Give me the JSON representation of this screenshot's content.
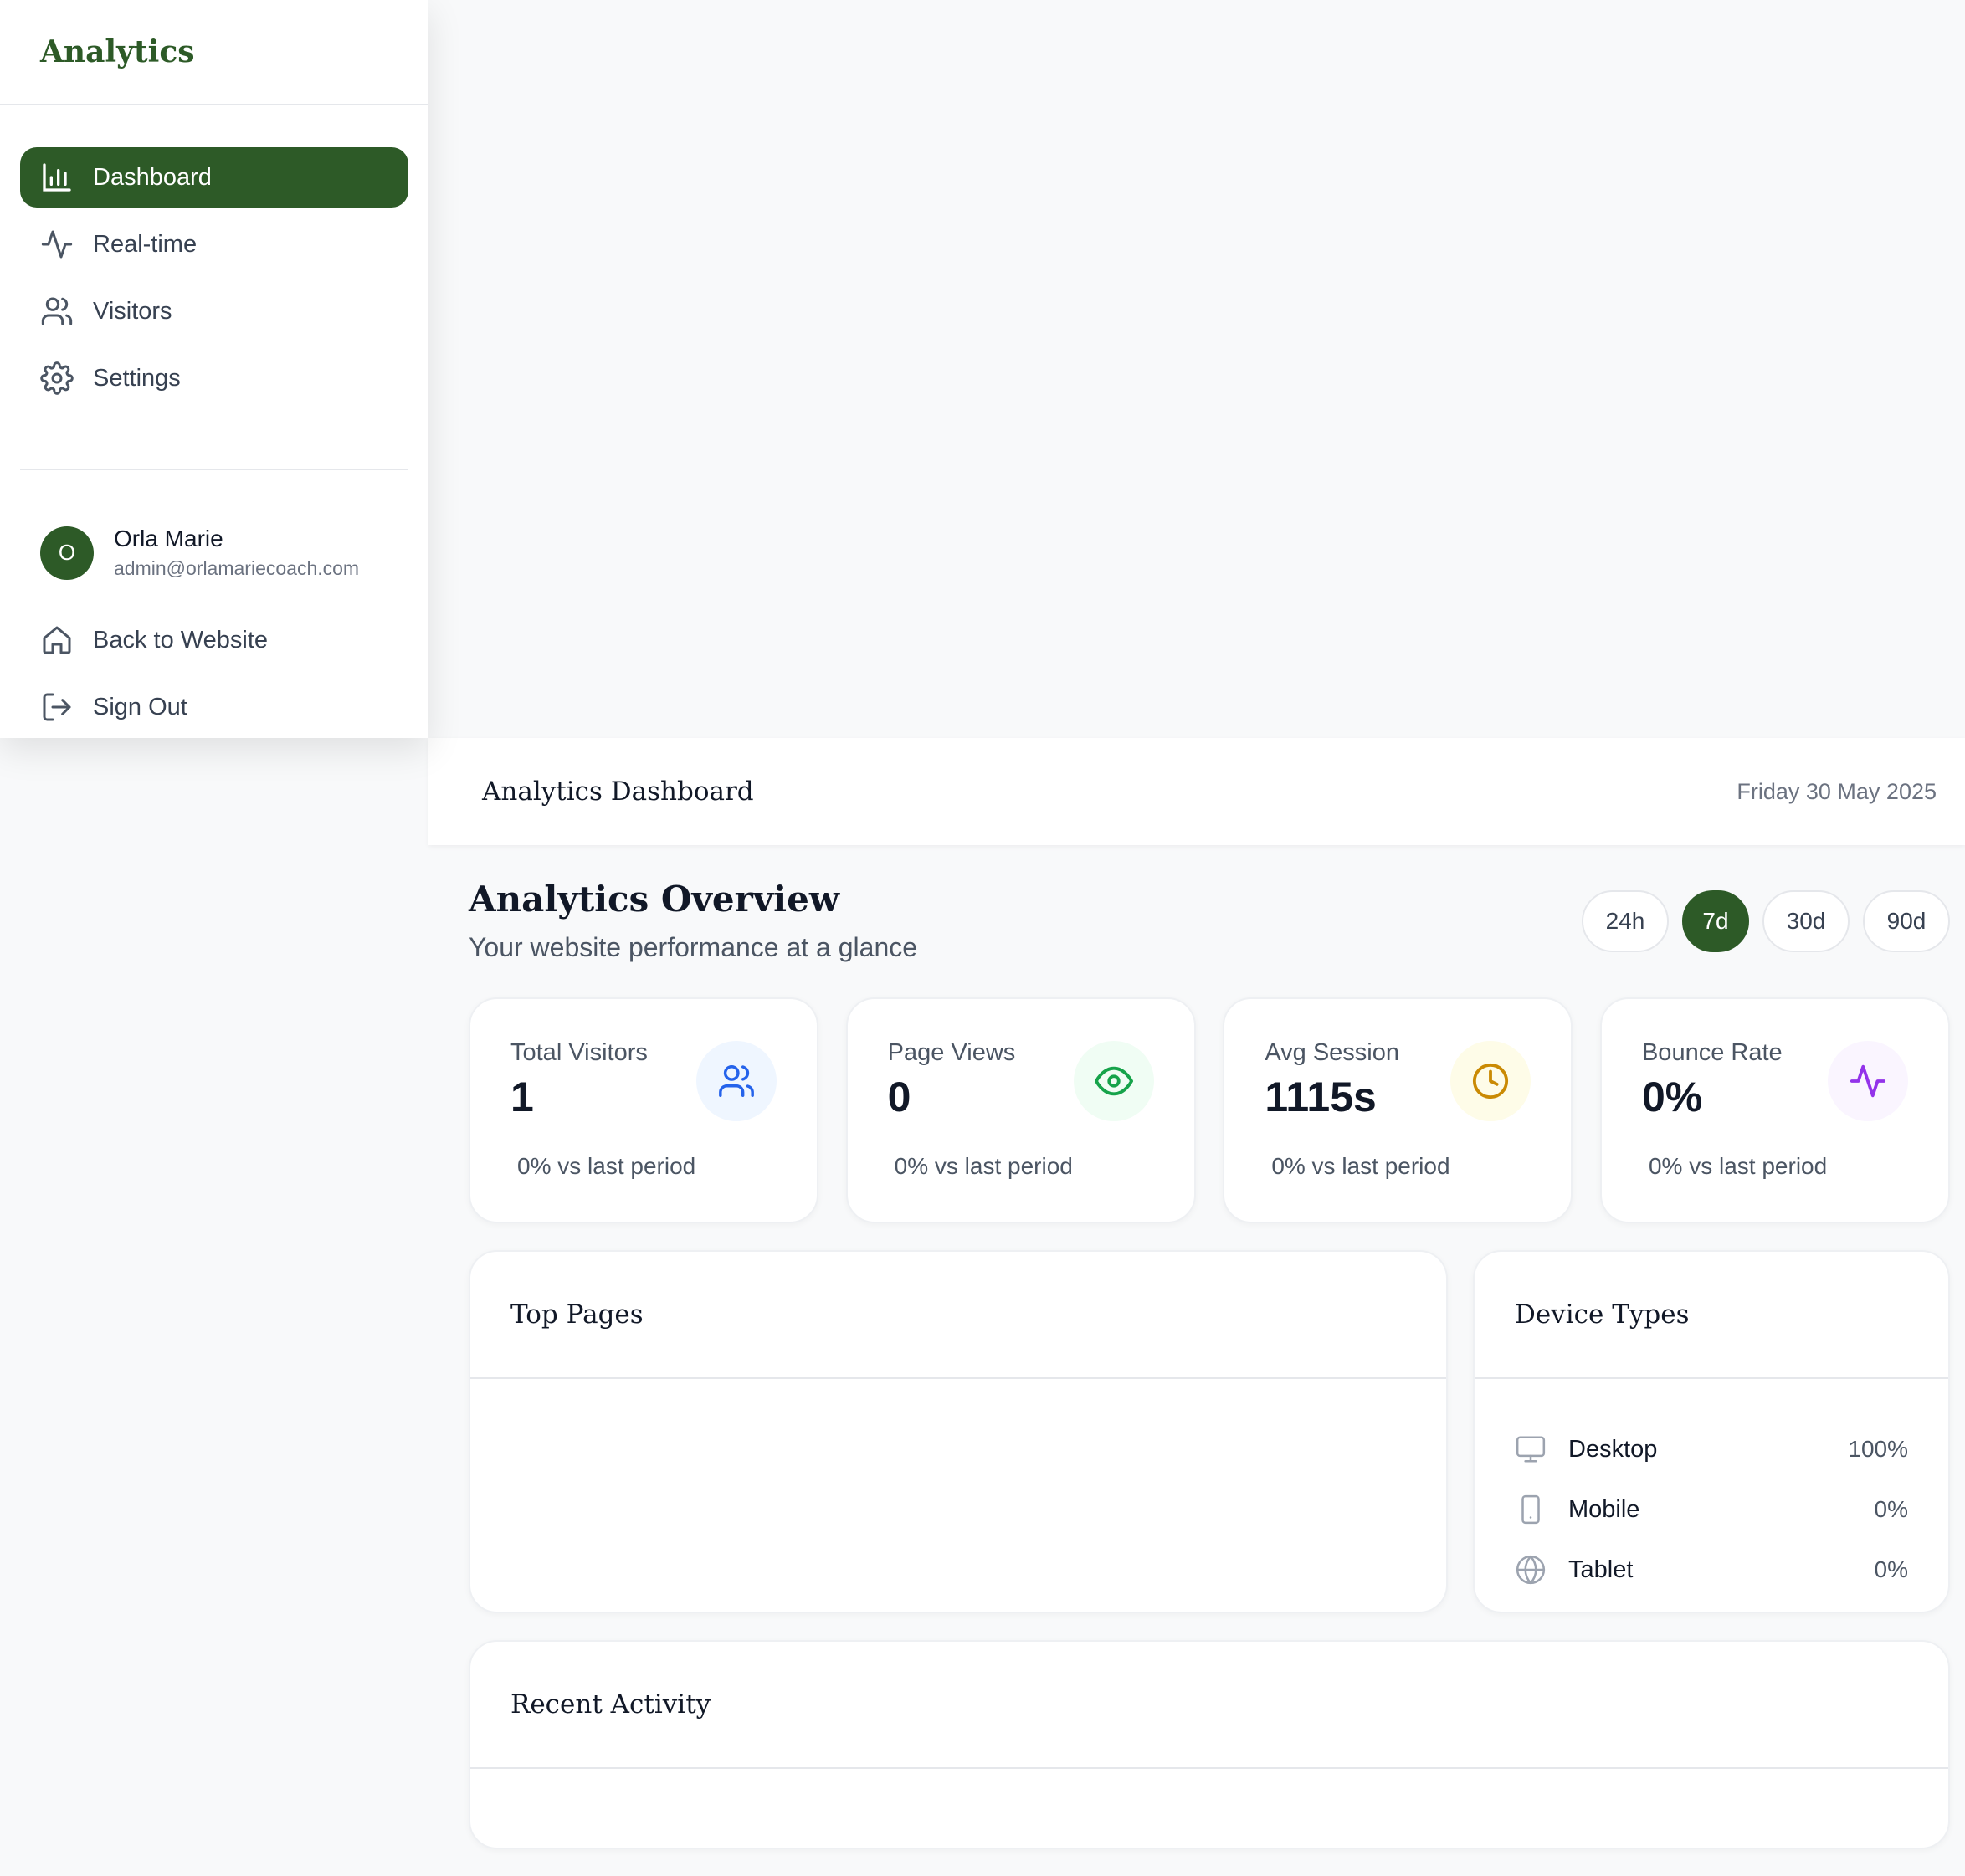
{
  "sidebar": {
    "logo": "Analytics",
    "nav": [
      {
        "label": "Dashboard",
        "icon": "bar-chart-icon",
        "active": true
      },
      {
        "label": "Real-time",
        "icon": "activity-icon",
        "active": false
      },
      {
        "label": "Visitors",
        "icon": "users-icon",
        "active": false
      },
      {
        "label": "Settings",
        "icon": "gear-icon",
        "active": false
      }
    ],
    "user": {
      "initial": "O",
      "name": "Orla Marie",
      "email": "admin@orlamariecoach.com"
    },
    "links": [
      {
        "label": "Back to Website",
        "icon": "home-icon"
      },
      {
        "label": "Sign Out",
        "icon": "log-out-icon"
      }
    ]
  },
  "header": {
    "title": "Analytics Dashboard",
    "date": "Friday 30 May 2025"
  },
  "overview": {
    "title": "Analytics Overview",
    "subtitle": "Your website performance at a glance",
    "ranges": [
      "24h",
      "7d",
      "30d",
      "90d"
    ],
    "selected_range": "7d"
  },
  "stats": [
    {
      "label": "Total Visitors",
      "value": "1",
      "change": "0% vs last period",
      "icon": "users-icon",
      "icon_color": "#2563eb",
      "badge_bg": "#eff6ff"
    },
    {
      "label": "Page Views",
      "value": "0",
      "change": "0% vs last period",
      "icon": "eye-icon",
      "icon_color": "#16a34a",
      "badge_bg": "#f0fdf4"
    },
    {
      "label": "Avg Session",
      "value": "1115s",
      "change": "0% vs last period",
      "icon": "clock-icon",
      "icon_color": "#ca8a04",
      "badge_bg": "#fefce8"
    },
    {
      "label": "Bounce Rate",
      "value": "0%",
      "change": "0% vs last period",
      "icon": "activity-icon",
      "icon_color": "#9333ea",
      "badge_bg": "#faf5ff"
    }
  ],
  "top_pages": {
    "title": "Top Pages"
  },
  "devices": {
    "title": "Device Types",
    "items": [
      {
        "name": "Desktop",
        "percent": "100%",
        "icon": "monitor-icon"
      },
      {
        "name": "Mobile",
        "percent": "0%",
        "icon": "smartphone-icon"
      },
      {
        "name": "Tablet",
        "percent": "0%",
        "icon": "globe-icon"
      }
    ]
  },
  "recent": {
    "title": "Recent Activity"
  },
  "colors": {
    "brand": "#2d5a27",
    "page_bg": "#f8f9fa",
    "border": "#e5e7eb"
  }
}
